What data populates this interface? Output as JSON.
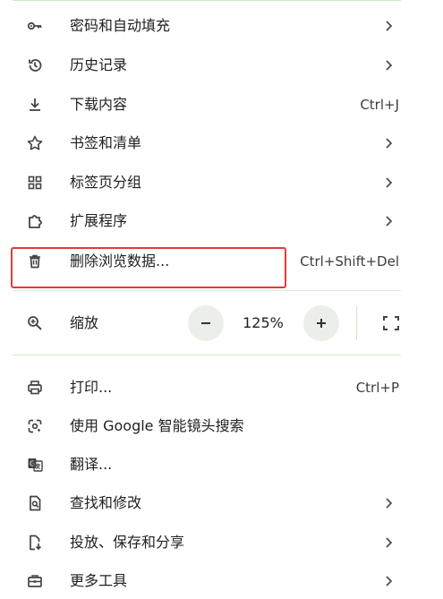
{
  "menu": {
    "items_top": [
      {
        "label": "密码和自动填充",
        "icon": "key-icon",
        "submenu": true
      },
      {
        "label": "历史记录",
        "icon": "history-icon",
        "submenu": true
      },
      {
        "label": "下载内容",
        "icon": "download-icon",
        "shortcut": "Ctrl+J"
      },
      {
        "label": "书签和清单",
        "icon": "star-icon",
        "submenu": true
      },
      {
        "label": "标签页分组",
        "icon": "tab-groups-icon",
        "submenu": true
      },
      {
        "label": "扩展程序",
        "icon": "extension-icon",
        "submenu": true
      },
      {
        "label": "删除浏览数据...",
        "icon": "trash-icon",
        "shortcut": "Ctrl+Shift+Del",
        "highlighted": true
      }
    ],
    "zoom": {
      "label": "缩放",
      "icon": "zoom-icon",
      "value": "125%"
    },
    "items_bottom": [
      {
        "label": "打印...",
        "icon": "print-icon",
        "shortcut": "Ctrl+P"
      },
      {
        "label": "使用 Google 智能镜头搜索",
        "icon": "google-lens-icon"
      },
      {
        "label": "翻译...",
        "icon": "translate-icon"
      },
      {
        "label": "查找和修改",
        "icon": "find-icon",
        "submenu": true
      },
      {
        "label": "投放、保存和分享",
        "icon": "cast-save-share-icon",
        "submenu": true
      },
      {
        "label": "更多工具",
        "icon": "toolbox-icon",
        "submenu": true
      }
    ]
  },
  "colors": {
    "highlight_border": "#e23b3b",
    "divider": "#d3ebcc",
    "zoom_button_bg": "#ecefe9",
    "text": "#1f1f1f"
  }
}
